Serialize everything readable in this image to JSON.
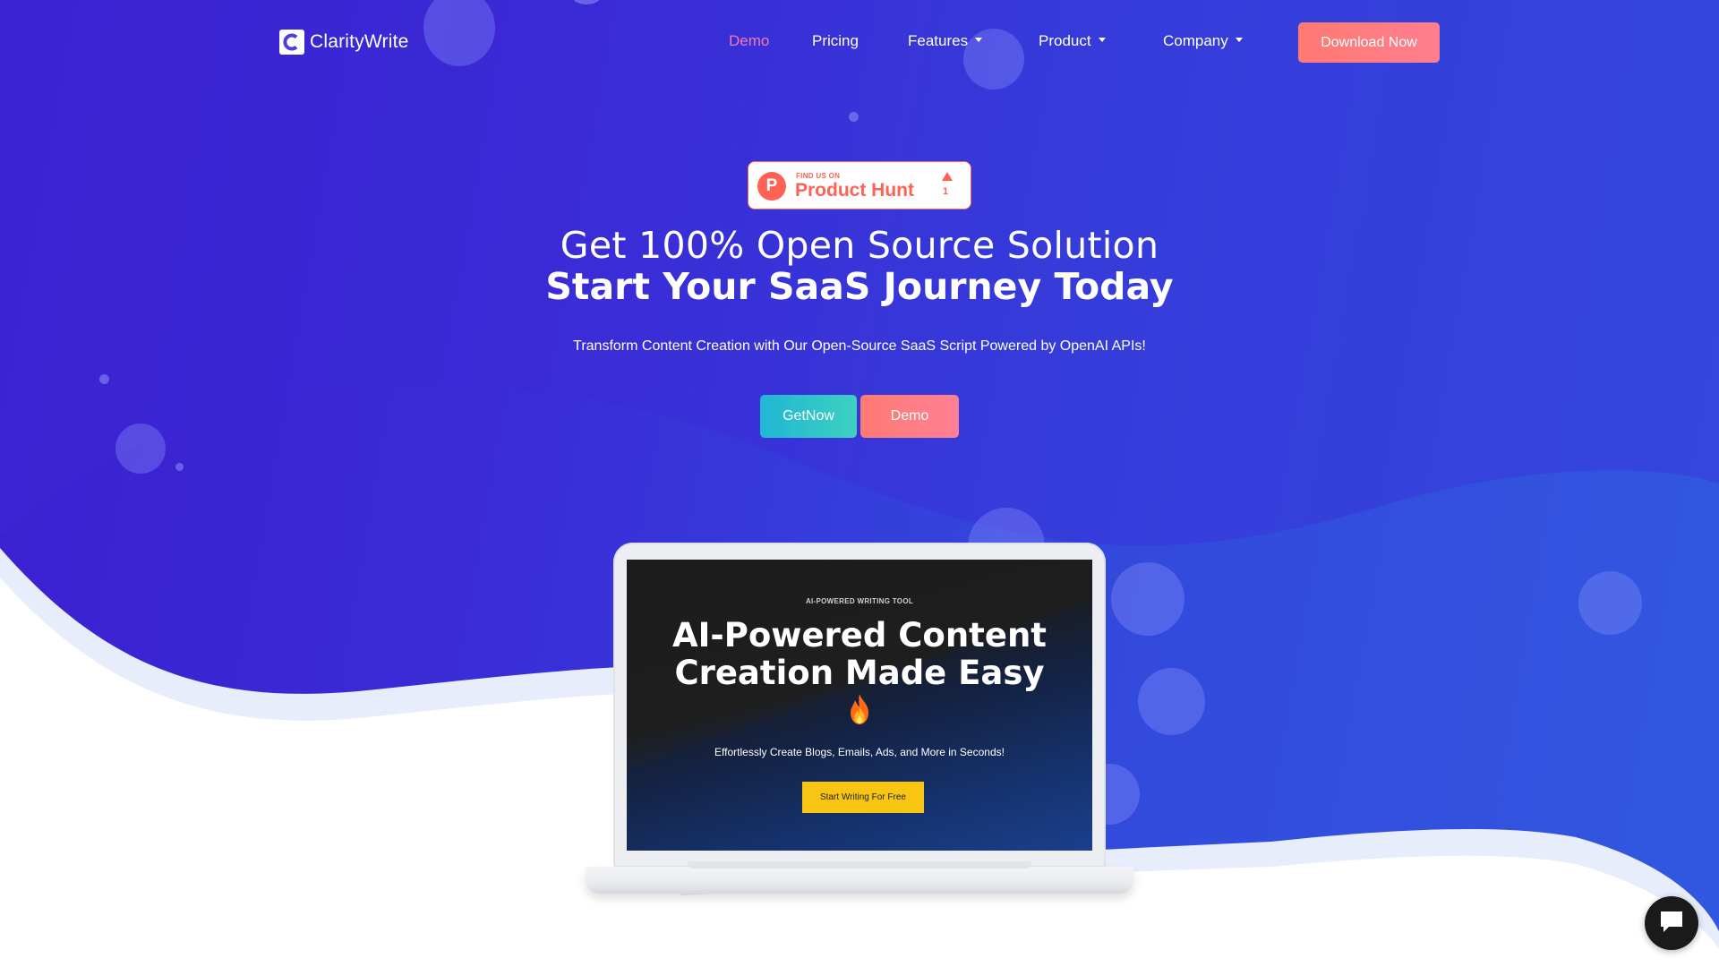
{
  "brand": {
    "name": "ClarityWrite"
  },
  "nav": {
    "items": [
      {
        "label": "Demo",
        "active": true,
        "dropdown": false
      },
      {
        "label": "Pricing",
        "active": false,
        "dropdown": false
      },
      {
        "label": "Features",
        "active": false,
        "dropdown": true
      },
      {
        "label": "Product",
        "active": false,
        "dropdown": true
      },
      {
        "label": "Company",
        "active": false,
        "dropdown": true
      }
    ],
    "cta_label": "Download Now"
  },
  "badge": {
    "small_text": "FIND US ON",
    "title": "Product Hunt",
    "logo_letter": "P",
    "upvotes": "1"
  },
  "hero": {
    "line1": "Get 100% Open Source Solution",
    "line2": "Start Your SaaS Journey Today",
    "subtext": "Transform Content Creation with Our Open-Source SaaS Script Powered by OpenAI APIs!",
    "primary_cta": "GetNow",
    "secondary_cta": "Demo"
  },
  "laptop_screen": {
    "kicker": "AI-POWERED WRITING TOOL",
    "title": "AI-Powered Content Creation Made Easy",
    "subtitle": "Effortlessly Create Blogs, Emails, Ads, and More in Seconds!",
    "button": "Start Writing For Free",
    "emoji_icon": "fire-icon"
  },
  "colors": {
    "hero_gradient_start": "#3d1fd0",
    "hero_gradient_end": "#3158e0",
    "accent_coral": "#ff7a72",
    "accent_teal": "#1fb7d4",
    "nav_active": "#f07ab8",
    "product_hunt": "#ff6154",
    "screen_button": "#f7c512"
  },
  "icons": [
    "claritywrite-logo-icon",
    "caret-down-icon",
    "product-hunt-logo-icon",
    "upvote-arrow-icon",
    "fire-icon",
    "chat-icon"
  ]
}
